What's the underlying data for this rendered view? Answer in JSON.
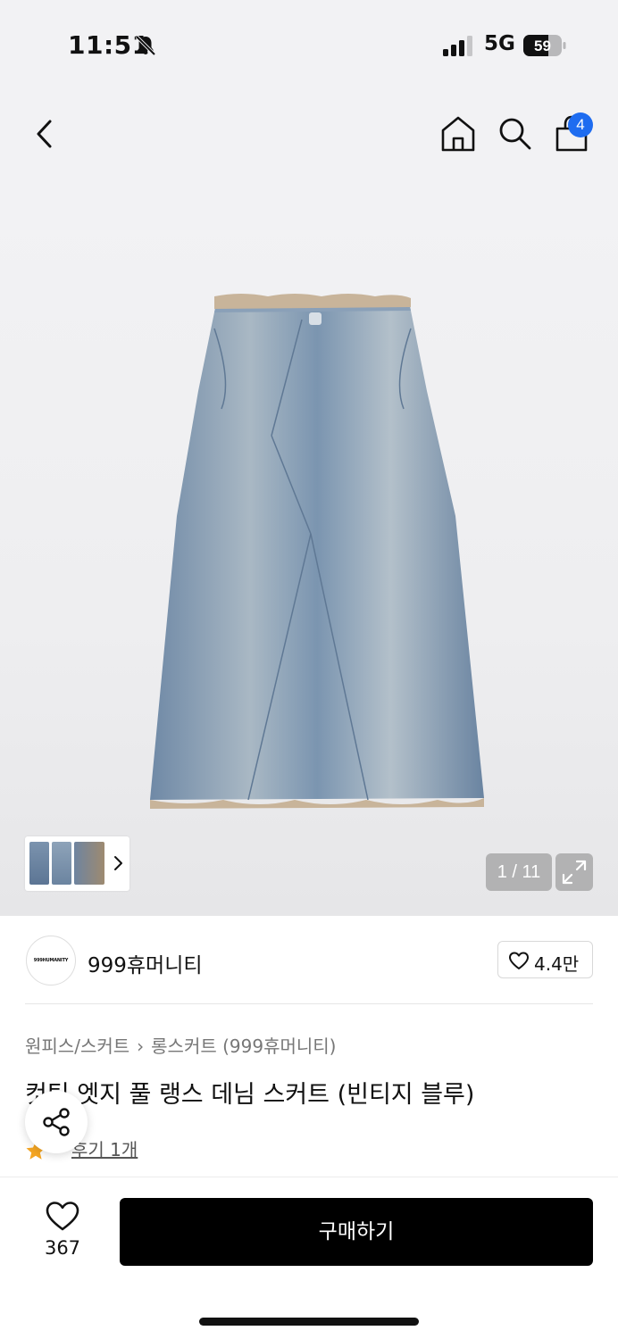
{
  "status_bar": {
    "time": "11:51",
    "network": "5G",
    "battery": "59",
    "icons": [
      "bell-slash-icon",
      "signal-icon",
      "battery-icon"
    ]
  },
  "header": {
    "icons": [
      "back-icon",
      "home-icon",
      "search-icon",
      "shopping-bag-icon"
    ],
    "cart_badge": "4",
    "badge_color": "#1e6cf0"
  },
  "gallery": {
    "counter": "1 / 11",
    "icons": [
      "expand-icon",
      "chevron-right-icon"
    ]
  },
  "brand": {
    "logo_text": "999HUMANITY",
    "name": "999휴머니티",
    "likes": "4.4만"
  },
  "product": {
    "breadcrumb": [
      "원피스/스커트",
      "롱스커트 (999휴머니티)"
    ],
    "title": "컷팅 엣지 풀 랭스 데님 스커트 (빈티지 블루)",
    "review_link": "후기 1개"
  },
  "bottom_bar": {
    "wish_count": "367",
    "buy_label": "구매하기"
  },
  "colors": {
    "background": "#f2f2f4",
    "buy_button": "#000000",
    "star": "#f5a623"
  }
}
